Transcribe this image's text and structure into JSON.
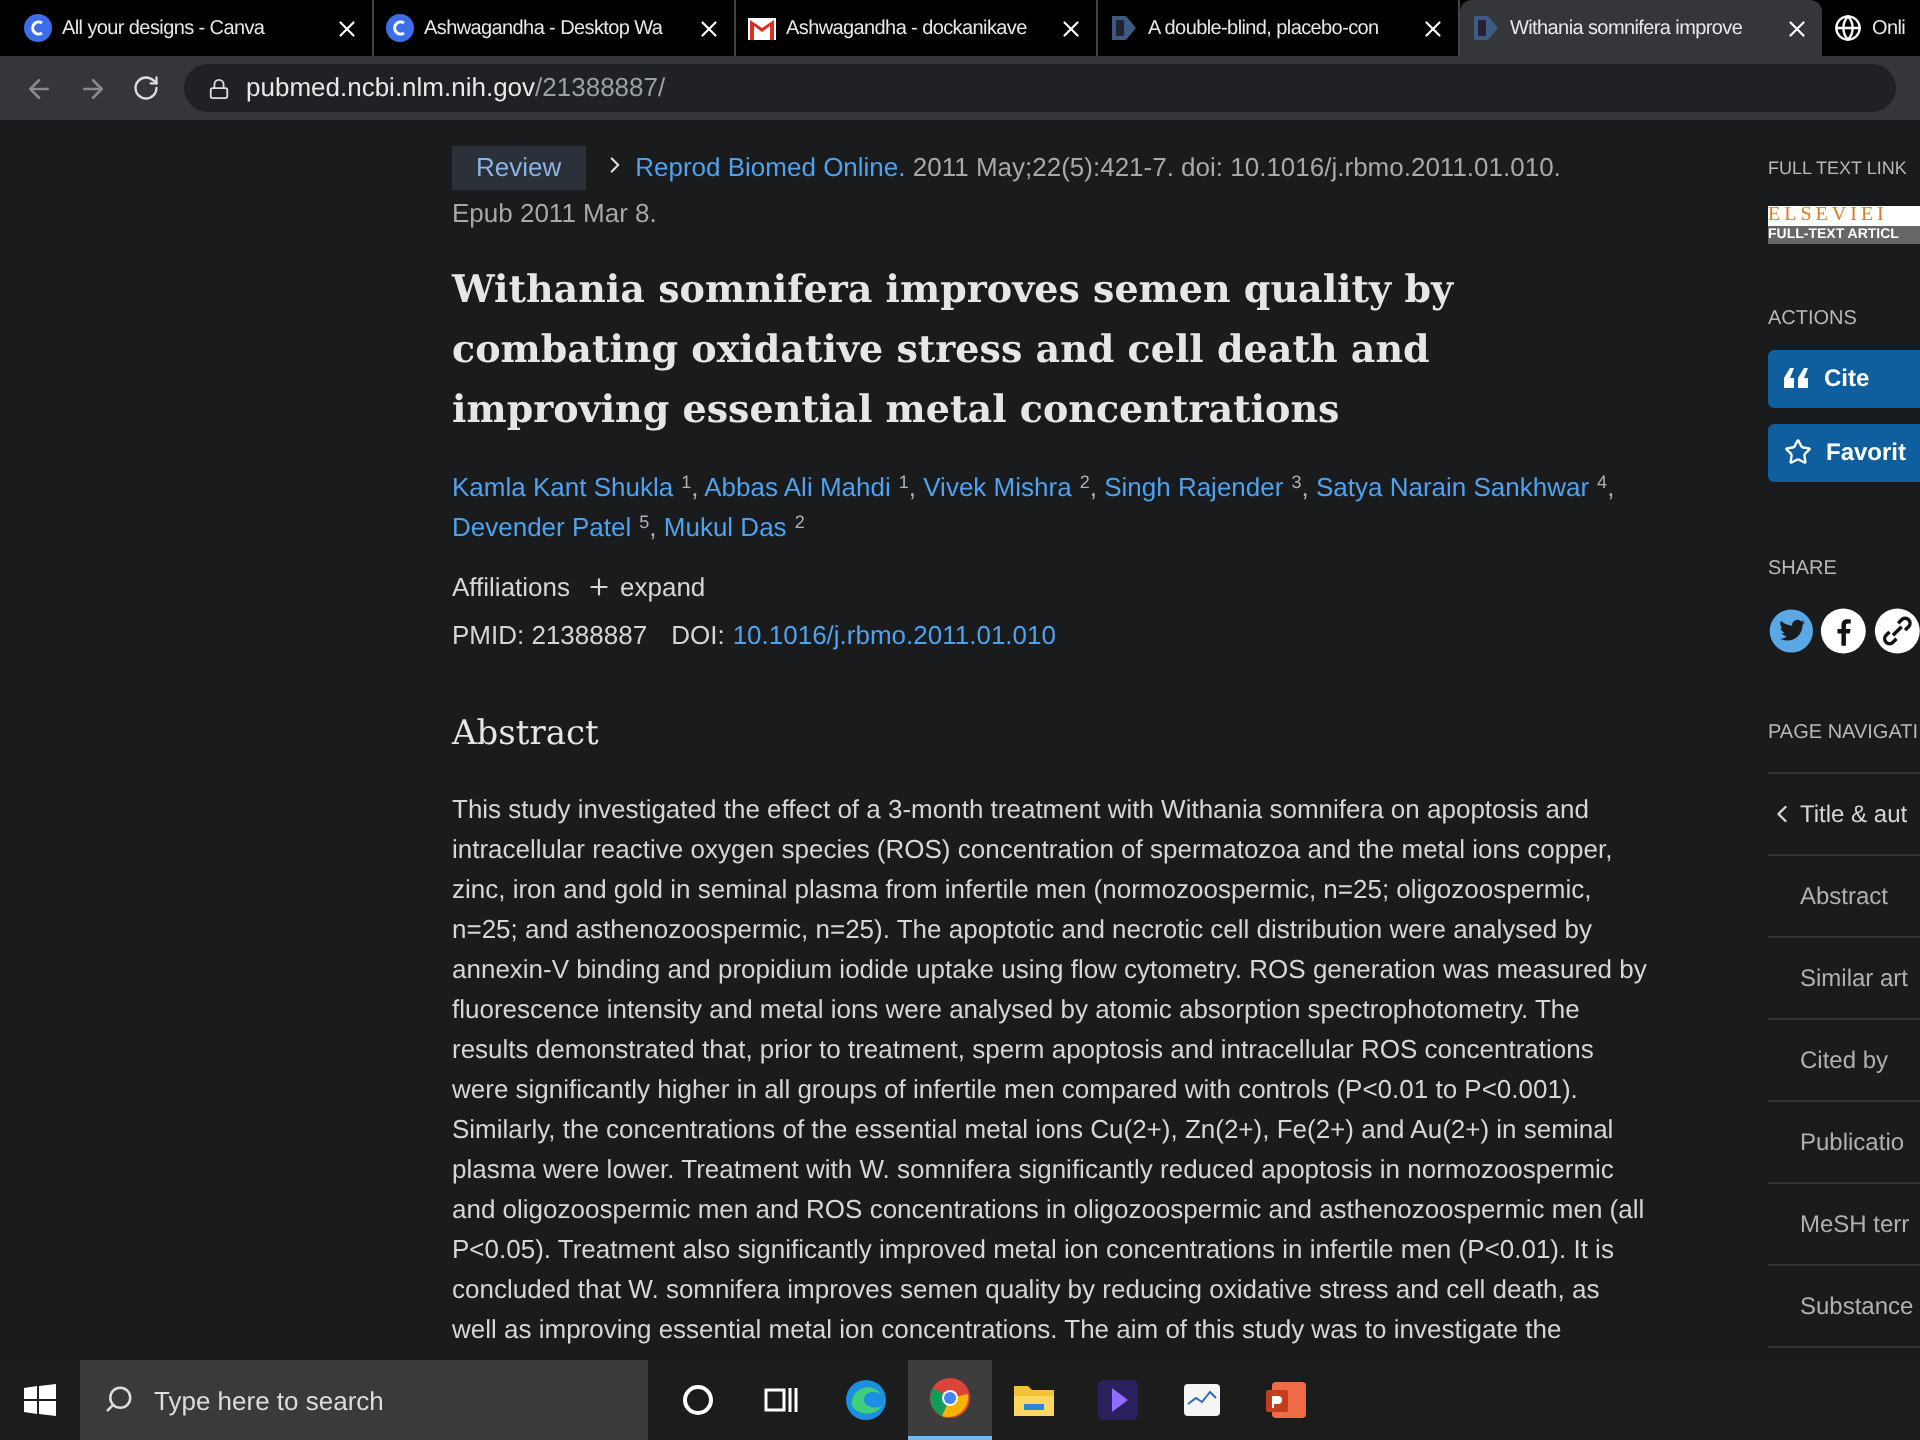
{
  "browser": {
    "tabs": [
      {
        "title": "All your designs - Canva",
        "kind": "canva",
        "selected": false
      },
      {
        "title": "Ashwagandha - Desktop Wa",
        "kind": "canva",
        "selected": false
      },
      {
        "title": "Ashwagandha - dockanikave",
        "kind": "mail",
        "selected": false
      },
      {
        "title": "A double-blind, placebo-con",
        "kind": "pubmed",
        "selected": false
      },
      {
        "title": "Withania somnifera improve",
        "kind": "pubmed",
        "selected": true
      },
      {
        "title": "Onli",
        "kind": "globe",
        "selected": false
      }
    ],
    "url_host": "pubmed.ncbi.nlm.nih.gov",
    "url_path": "/21388887/"
  },
  "article": {
    "type_badge": "Review",
    "journal": "Reprod Biomed Online.",
    "citation": "2011 May;22(5):421-7. doi: 10.1016/j.rbmo.2011.01.010.",
    "epub": "Epub 2011 Mar 8.",
    "title": "Withania somnifera improves semen quality by combating oxidative stress and cell death and improving essential metal concentrations",
    "authors": [
      {
        "name": "Kamla Kant Shukla",
        "sup": "1",
        "sep": ","
      },
      {
        "name": "Abbas Ali Mahdi",
        "sup": "1",
        "sep": ","
      },
      {
        "name": "Vivek Mishra",
        "sup": "2",
        "sep": ","
      },
      {
        "name": "Singh Rajender",
        "sup": "3",
        "sep": ","
      },
      {
        "name": "Satya Narain Sankhwar",
        "sup": "4",
        "sep": ","
      },
      {
        "name": "Devender Patel",
        "sup": "5",
        "sep": ","
      },
      {
        "name": "Mukul Das",
        "sup": "2"
      }
    ],
    "affiliations_label": "Affiliations",
    "expand_label": "expand",
    "pmid": "PMID: 21388887",
    "doi_label": "DOI:",
    "doi": "10.1016/j.rbmo.2011.01.010",
    "abstract_heading": "Abstract",
    "abstract": "This study investigated the effect of a 3-month treatment with Withania somnifera on apoptosis and intracellular reactive oxygen species (ROS) concentration of spermatozoa and the metal ions copper, zinc, iron and gold in seminal plasma from infertile men (normozoospermic, n=25; oligozoospermic, n=25; and asthenozoospermic, n=25). The apoptotic and necrotic cell distribution were analysed by annexin-V binding and propidium iodide uptake using flow cytometry. ROS generation was measured by fluorescence intensity and metal ions were analysed by atomic absorption spectrophotometry. The results demonstrated that, prior to treatment, sperm apoptosis and intracellular ROS concentrations were significantly higher in all groups of infertile men compared with controls (P<0.01 to P<0.001). Similarly, the concentrations of the essential metal ions Cu(2+), Zn(2+), Fe(2+) and Au(2+) in seminal plasma were lower. Treatment with W. somnifera significantly reduced apoptosis in normozoospermic and oligozoospermic men and ROS concentrations in oligozoospermic and asthenozoospermic men (all P<0.05). Treatment also significantly improved metal ion concentrations in infertile men (P<0.01). It is concluded that W. somnifera improves semen quality by reducing oxidative stress and cell death, as well as improving essential metal ion concentrations. The aim of this study was to investigate the"
  },
  "sidebar": {
    "full_text_heading": "FULL TEXT LINK",
    "publisher_logo": "ELSEVIEI",
    "publisher_sub": "FULL-TEXT ARTICL",
    "actions_heading": "ACTIONS",
    "actions": [
      {
        "label": "Cite",
        "kind": "quote"
      },
      {
        "label": "Favorit",
        "kind": "star"
      }
    ],
    "share_heading": "SHARE",
    "share": [
      {
        "kind": "twitter"
      },
      {
        "kind": "facebook"
      },
      {
        "kind": "link"
      }
    ],
    "nav_heading": "PAGE NAVIGATI",
    "nav": [
      {
        "label": "Title & aut",
        "selected": true
      },
      {
        "label": "Abstract",
        "selected": false
      },
      {
        "label": "Similar art",
        "selected": false
      },
      {
        "label": "Cited by",
        "selected": false
      },
      {
        "label": "Publicatio",
        "selected": false
      },
      {
        "label": "MeSH terr",
        "selected": false
      },
      {
        "label": "Substance",
        "selected": false
      }
    ]
  },
  "taskbar": {
    "search_placeholder": "Type here to search",
    "apps": [
      {
        "kind": "cortana",
        "active": false
      },
      {
        "kind": "taskview",
        "active": false
      },
      {
        "kind": "edge",
        "active": false
      },
      {
        "kind": "chrome",
        "active": true
      },
      {
        "kind": "folder",
        "active": false
      },
      {
        "kind": "video",
        "active": false
      },
      {
        "kind": "monitor",
        "active": false
      },
      {
        "kind": "powerpoint",
        "active": false
      }
    ]
  }
}
